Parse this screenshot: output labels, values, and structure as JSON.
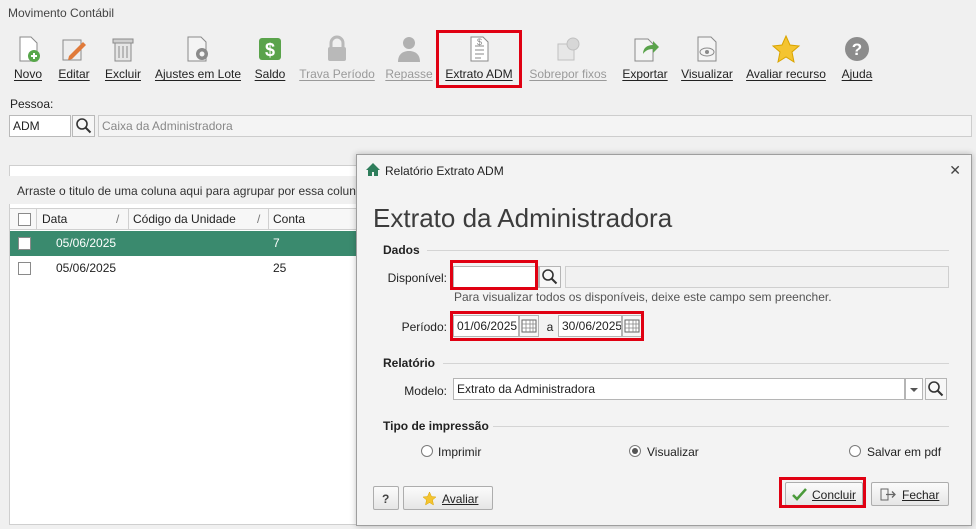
{
  "window": {
    "title": "Movimento Contábil"
  },
  "toolbar": {
    "buttons": [
      {
        "label": "Novo"
      },
      {
        "label": "Editar"
      },
      {
        "label": "Excluir"
      },
      {
        "label": "Ajustes em Lote"
      },
      {
        "label": "Saldo"
      },
      {
        "label": "Trava Período"
      },
      {
        "label": "Repasse"
      },
      {
        "label": "Extrato ADM"
      },
      {
        "label": "Sobrepor fixos"
      },
      {
        "label": "Exportar"
      },
      {
        "label": "Visualizar"
      },
      {
        "label": "Avaliar recurso"
      },
      {
        "label": "Ajuda"
      }
    ]
  },
  "pessoa": {
    "label": "Pessoa:",
    "code": "ADM",
    "name": "Caixa da Administradora"
  },
  "grid": {
    "group_hint": "Arraste o titulo de uma coluna aqui para agrupar por essa coluna",
    "columns": [
      "Data",
      "Código da Unidade",
      "Conta"
    ],
    "rows": [
      {
        "data": "05/06/2025",
        "conta": "7"
      },
      {
        "data": "05/06/2025",
        "conta": "25"
      }
    ]
  },
  "dialog": {
    "title": "Relatório Extrato ADM",
    "close_glyph": "✕",
    "heading": "Extrato da Administradora",
    "dados": {
      "section": "Dados",
      "disponivel_label": "Disponível:",
      "disponivel_value": "",
      "disponivel_desc": "",
      "hint": "Para visualizar todos os disponíveis, deixe este campo sem preencher.",
      "periodo_label": "Período:",
      "periodo_from": "01/06/2025",
      "periodo_sep": "a",
      "periodo_to": "30/06/2025"
    },
    "relatorio": {
      "section": "Relatório",
      "modelo_label": "Modelo:",
      "modelo_value": "Extrato da Administradora"
    },
    "tipo": {
      "section": "Tipo de impressão",
      "options": [
        "Imprimir",
        "Visualizar",
        "Salvar em pdf"
      ],
      "selected": "Visualizar"
    },
    "buttons": {
      "help": "?",
      "avaliar": "Avaliar",
      "concluir": "Concluir",
      "fechar": "Fechar"
    }
  },
  "colors": {
    "selected_row": "#3a8a6e",
    "highlight": "#e00012",
    "accent": "#2e7d5b"
  }
}
